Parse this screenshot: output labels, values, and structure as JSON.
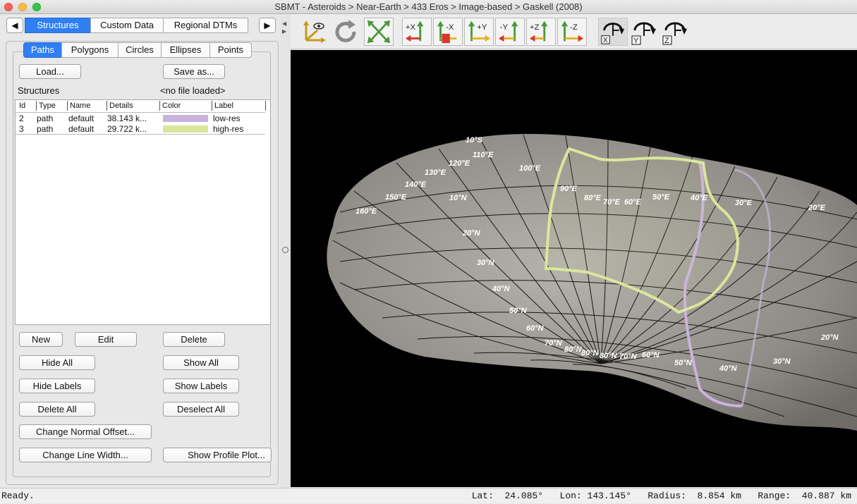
{
  "window": {
    "title": "SBMT - Asteroids > Near-Earth > 433 Eros > Image-based > Gaskell (2008)"
  },
  "tabs": {
    "left_arrow": "◀",
    "right_arrow": "▶",
    "items": [
      "Structures",
      "Custom Data",
      "Regional DTMs"
    ],
    "selected": "Structures"
  },
  "subtabs": {
    "items": [
      "Paths",
      "Polygons",
      "Circles",
      "Ellipses",
      "Points"
    ],
    "selected": "Paths"
  },
  "panel": {
    "load_label": "Load...",
    "saveas_label": "Save as...",
    "structures_label": "Structures",
    "file_status": "<no file loaded>"
  },
  "table": {
    "headers": [
      "Id",
      "Type",
      "Name",
      "Details",
      "Color",
      "Label"
    ],
    "rows": [
      {
        "id": "2",
        "type": "path",
        "name": "default",
        "details": "38.143 k...",
        "color": "#c9b3dd",
        "label": "low-res"
      },
      {
        "id": "3",
        "type": "path",
        "name": "default",
        "details": "29.722 k...",
        "color": "#d9e79b",
        "label": "high-res"
      }
    ]
  },
  "buttons": {
    "new": "New",
    "edit": "Edit",
    "delete": "Delete",
    "hide_all": "Hide All",
    "show_all": "Show All",
    "hide_labels": "Hide Labels",
    "show_labels": "Show Labels",
    "delete_all": "Delete All",
    "deselect_all": "Deselect All",
    "change_normal_offset": "Change Normal Offset...",
    "change_line_width": "Change Line Width...",
    "show_profile_plot": "Show Profile Plot..."
  },
  "toolbar": {
    "buttons": [
      {
        "icon": "set-viewpoint-icon",
        "label": ""
      },
      {
        "icon": "reset-rotation-icon",
        "label": ""
      },
      {
        "icon": "fit-view-icon",
        "label": ""
      },
      {
        "icon": "view-plus-x-icon",
        "label": "+X"
      },
      {
        "icon": "view-minus-x-icon",
        "label": "-X"
      },
      {
        "icon": "view-plus-y-icon",
        "label": "+Y"
      },
      {
        "icon": "view-minus-y-icon",
        "label": "-Y"
      },
      {
        "icon": "view-plus-z-icon",
        "label": "+Z"
      },
      {
        "icon": "view-minus-z-icon",
        "label": "-Z"
      },
      {
        "icon": "rotate-x-icon",
        "label": "X"
      },
      {
        "icon": "rotate-y-icon",
        "label": "Y"
      },
      {
        "icon": "rotate-z-icon",
        "label": "Z"
      }
    ]
  },
  "map_labels": [
    "10°S",
    "110°E",
    "120°E",
    "130°E",
    "140°E",
    "150°E",
    "160°E",
    "100°E",
    "10°N",
    "90°E",
    "80°E",
    "70°E",
    "60°E",
    "50°E",
    "40°E",
    "30°E",
    "20°E",
    "20°N",
    "30°N",
    "40°N",
    "50°N",
    "60°N",
    "70°N",
    "80°N",
    "80°N",
    "80°N",
    "70°N",
    "60°N",
    "50°N",
    "40°N",
    "30°N",
    "20°N"
  ],
  "status": {
    "left": "Ready.",
    "lat": "Lat:  24.085°",
    "lon": "Lon: 143.145°",
    "radius": "Radius:  8.854 km",
    "range": "Range:  40.887 km"
  },
  "colors": {
    "accent": "#2f7ff2",
    "lowres": "#c9b3dd",
    "highres": "#d9e79b"
  }
}
